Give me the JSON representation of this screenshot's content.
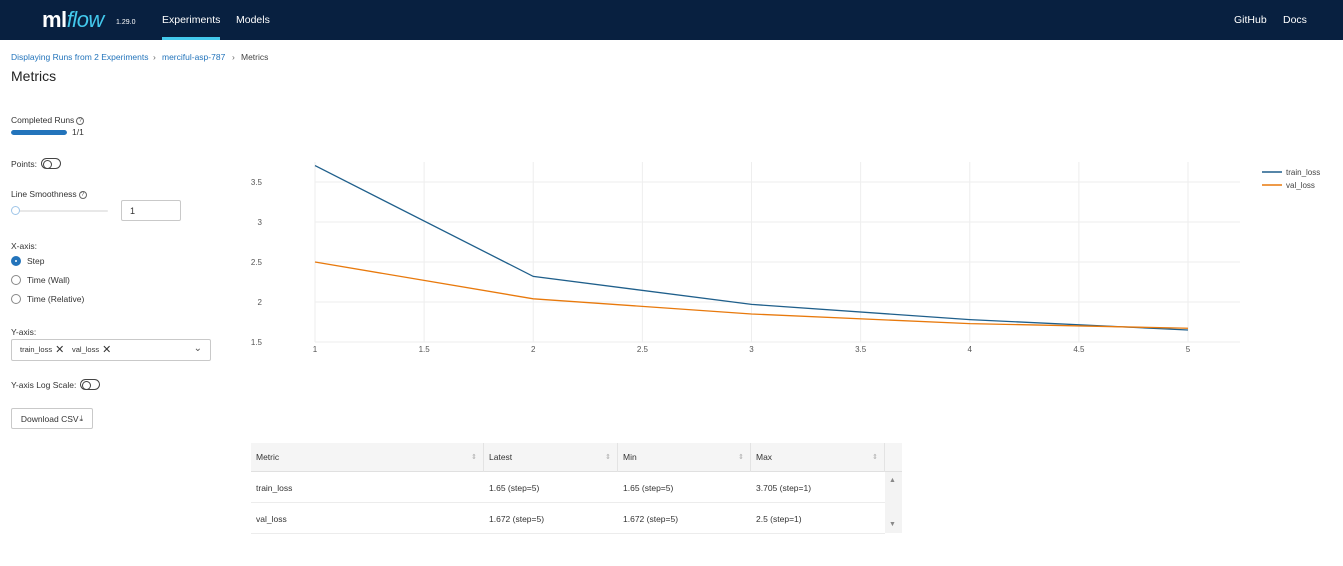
{
  "header": {
    "logo_ml": "ml",
    "logo_flow": "flow",
    "version": "1.29.0",
    "nav": [
      "Experiments",
      "Models"
    ],
    "right_links": [
      "GitHub",
      "Docs"
    ]
  },
  "breadcrumb": {
    "items": [
      "Displaying Runs from 2 Experiments",
      "merciful-asp-787",
      "Metrics"
    ],
    "separator": "›"
  },
  "page_title": "Metrics",
  "controls": {
    "completed_runs_label": "Completed Runs",
    "completed_runs_text": "1/1",
    "completed_runs_fraction": 1.0,
    "points_label": "Points:",
    "points_on": false,
    "line_smoothness_label": "Line Smoothness",
    "line_smoothness_value": "1",
    "xaxis_label": "X-axis:",
    "xaxis_options": [
      "Step",
      "Time (Wall)",
      "Time (Relative)"
    ],
    "xaxis_selected": "Step",
    "yaxis_label": "Y-axis:",
    "yaxis_tags": [
      "train_loss",
      "val_loss"
    ],
    "yaxis_log_label": "Y-axis Log Scale:",
    "yaxis_log_on": false,
    "download_label": "Download CSV"
  },
  "chart_data": {
    "type": "line",
    "x": [
      1,
      2,
      3,
      4,
      5
    ],
    "series": [
      {
        "name": "train_loss",
        "color": "#1f5f8b",
        "values": [
          3.705,
          2.32,
          1.97,
          1.78,
          1.65
        ]
      },
      {
        "name": "val_loss",
        "color": "#e8790c",
        "values": [
          2.5,
          2.04,
          1.85,
          1.73,
          1.672
        ]
      }
    ],
    "xlim": [
      1,
      5
    ],
    "ylim": [
      1.5,
      3.75
    ],
    "x_ticks": [
      "1",
      "1.5",
      "2",
      "2.5",
      "3",
      "3.5",
      "4",
      "4.5",
      "5"
    ],
    "y_ticks": [
      "1.5",
      "2",
      "2.5",
      "3",
      "3.5"
    ],
    "grid": true,
    "legend_position": "top-right"
  },
  "metrics_table": {
    "columns": [
      "Metric",
      "Latest",
      "Min",
      "Max"
    ],
    "rows": [
      [
        "train_loss",
        "1.65 (step=5)",
        "1.65 (step=5)",
        "3.705 (step=1)"
      ],
      [
        "val_loss",
        "1.672 (step=5)",
        "1.672 (step=5)",
        "2.5 (step=1)"
      ]
    ]
  }
}
